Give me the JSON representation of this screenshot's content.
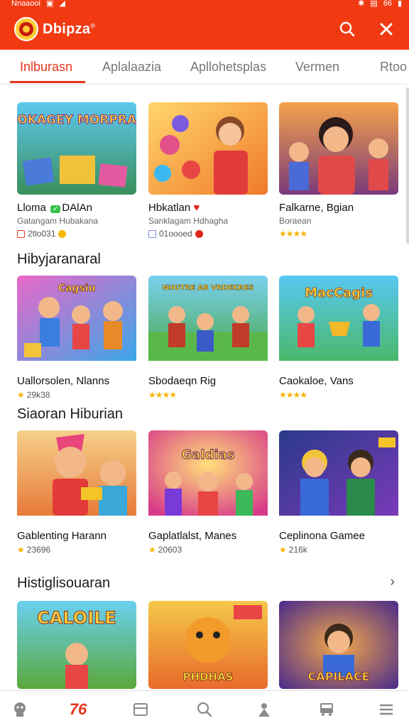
{
  "status": {
    "left_text": "Nnaaooi",
    "right_text": "66"
  },
  "app": {
    "title": "Dbipza",
    "title_mark": "®",
    "brand_color": "#f23a12"
  },
  "tabs": [
    {
      "label": "Inlburasn",
      "active": true
    },
    {
      "label": "Aplalaazia",
      "active": false
    },
    {
      "label": "Apllohetsplas",
      "active": false
    },
    {
      "label": "Vermen",
      "active": false
    },
    {
      "label": "Rtoo",
      "active": false
    }
  ],
  "sections": [
    {
      "title": "",
      "cards": [
        {
          "thumb_text": "SHOKAGEY MORPRAGS",
          "title": "Lloma",
          "title_tag": "DAlAn",
          "subtitle": "Gatangam Hubakana",
          "meta": "2tlo031"
        },
        {
          "thumb_text": "",
          "title": "Hbkatlan",
          "title_tag": "♥",
          "subtitle": "Sanklagam Hdhagha",
          "meta": "01oooed"
        },
        {
          "thumb_text": "",
          "title": "Falkarne, Bgian",
          "title_tag": "",
          "subtitle": "Boraean",
          "meta": "★★★★"
        }
      ]
    },
    {
      "title": "Hibyjaranaral",
      "cards": [
        {
          "thumb_text": "Cagsiu",
          "title": "Uallorsolen, Nlanns",
          "meta_stars": "★",
          "meta": "29k38"
        },
        {
          "thumb_text": "NHUTRE AB VRDEKRES",
          "title": "Sbodaeqn Rig",
          "meta_stars": "★★★★",
          "meta": ""
        },
        {
          "thumb_text": "MacCagis",
          "title": "Caokaloe, Vans",
          "meta_stars": "★★★★",
          "meta": ""
        }
      ]
    },
    {
      "title": "Siaoran Hiburian",
      "cards": [
        {
          "thumb_text": "",
          "title": "Gablenting Harann",
          "meta_stars": "★",
          "meta": "23696"
        },
        {
          "thumb_text": "Galdias",
          "title": "Gaplatlalst, Manes",
          "meta_stars": "★",
          "meta": "20603"
        },
        {
          "thumb_text": "",
          "title": "Ceplinona Gamee",
          "meta_stars": "★",
          "meta": "216k"
        }
      ]
    },
    {
      "title": "Histiglisouaran",
      "arrow": "›",
      "cards": [
        {
          "thumb_text": "CALOILE",
          "title": ""
        },
        {
          "thumb_text": "PHDHAS",
          "title": ""
        },
        {
          "thumb_text": "CAPILACE",
          "title": ""
        }
      ]
    }
  ],
  "bottom_nav": [
    {
      "icon": "robot-icon",
      "active": false
    },
    {
      "icon": "logo-icon",
      "label": "76",
      "active": true
    },
    {
      "icon": "book-icon",
      "active": false
    },
    {
      "icon": "search-icon",
      "active": false
    },
    {
      "icon": "person-icon",
      "active": false
    },
    {
      "icon": "bus-icon",
      "active": false
    },
    {
      "icon": "menu-icon",
      "active": false
    }
  ],
  "colors": {
    "accent": "#e8351b",
    "star": "#f5b301"
  }
}
